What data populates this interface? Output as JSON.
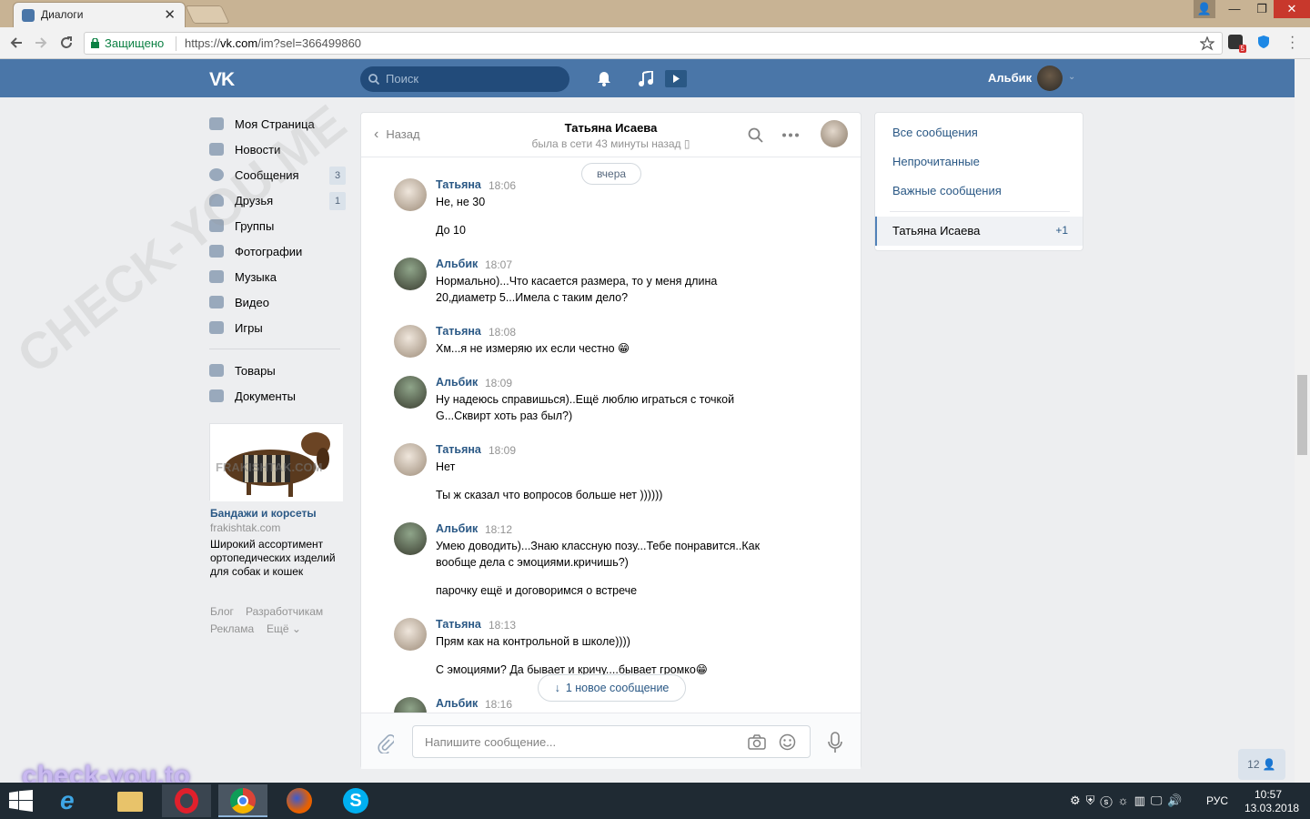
{
  "browser": {
    "tab_title": "Диалоги",
    "secure_label": "Защищено",
    "url_prefix": "https://",
    "url_host": "vk.com",
    "url_path": "/im?sel=366499860",
    "ext_badge": "5"
  },
  "vk": {
    "logo": "VK",
    "search_placeholder": "Поиск",
    "profile_name": "Альбик"
  },
  "sidebar": {
    "items": [
      {
        "label": "Моя Страница",
        "count": ""
      },
      {
        "label": "Новости",
        "count": ""
      },
      {
        "label": "Сообщения",
        "count": "3"
      },
      {
        "label": "Друзья",
        "count": "1"
      },
      {
        "label": "Группы",
        "count": ""
      },
      {
        "label": "Фотографии",
        "count": ""
      },
      {
        "label": "Музыка",
        "count": ""
      },
      {
        "label": "Видео",
        "count": ""
      },
      {
        "label": "Игры",
        "count": ""
      },
      {
        "label": "Товары",
        "count": ""
      },
      {
        "label": "Документы",
        "count": ""
      }
    ],
    "ad": {
      "image_text": "FRAKISHTAK.COM",
      "title": "Бандажи и корсеты",
      "domain": "frakishtak.com",
      "text": "Широкий ассортимент ортопедических изделий для собак и кошек"
    },
    "footer": {
      "blog": "Блог",
      "dev": "Разработчикам",
      "ads": "Реклама",
      "more": "Ещё"
    }
  },
  "chat": {
    "back_label": "Назад",
    "name": "Татьяна Исаева",
    "status": "была в сети 43 минуты назад",
    "date_pill": "вчера",
    "new_message_label": "1 новое сообщение",
    "input_placeholder": "Напишите сообщение...",
    "messages": [
      {
        "author": "Татьяна",
        "time": "18:06",
        "lines": [
          "Не, не 30",
          "До 10"
        ]
      },
      {
        "author": "Альбик",
        "time": "18:07",
        "lines": [
          "Нормально)...Что касается размера, то у меня длина 20,диаметр 5...Имела с таким дело?"
        ]
      },
      {
        "author": "Татьяна",
        "time": "18:08",
        "lines": [
          "Хм...я не измеряю их если честно 😁"
        ]
      },
      {
        "author": "Альбик",
        "time": "18:09",
        "lines": [
          "Ну надеюсь справишься)..Ещё люблю играться с точкой G...Сквирт хоть раз был?)"
        ]
      },
      {
        "author": "Татьяна",
        "time": "18:09",
        "lines": [
          "Нет",
          "Ты ж сказал что вопросов больше нет ))))))"
        ]
      },
      {
        "author": "Альбик",
        "time": "18:12",
        "lines": [
          "Умею доводить)...Знаю классную позу...Тебе понравится..Как вообще дела с эмоциями.кричишь?)",
          "парочку ещё и договоримся о встрече"
        ]
      },
      {
        "author": "Татьяна",
        "time": "18:13",
        "lines": [
          "Прям как на контрольной в школе))))",
          "С эмоциями? Да бывает и кричу....бывает громко😁"
        ]
      },
      {
        "author": "Альбик",
        "time": "18:16",
        "lines": []
      }
    ]
  },
  "right_panel": {
    "all": "Все сообщения",
    "unread": "Непрочитанные",
    "important": "Важные сообщения",
    "active_name": "Татьяна Исаева",
    "active_count": "+1"
  },
  "online_count": "12",
  "taskbar": {
    "lang": "РУС",
    "time": "10:57",
    "date": "13.03.2018"
  },
  "watermarks": {
    "main": "CHECK-YOU.ME",
    "bottom": "check-you.to"
  }
}
